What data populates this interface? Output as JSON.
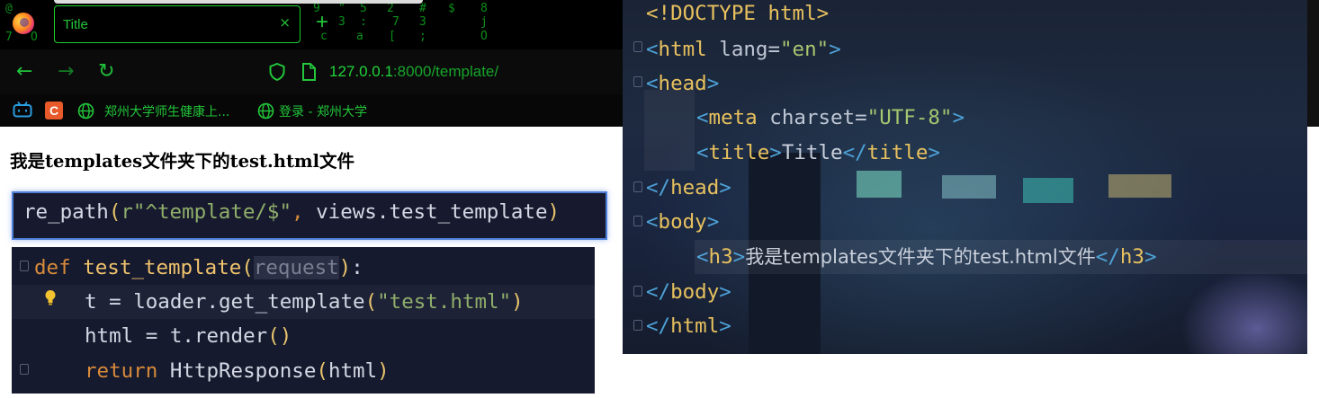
{
  "browser": {
    "tab_title": "Title",
    "url_host": "127.0.0.1",
    "url_rest": ":8000/template/",
    "bookmarks": [
      {
        "label": "郑州大学师生健康上...",
        "icon": "globe-icon"
      },
      {
        "label": "登录 - 郑州大学",
        "icon": "globe-icon"
      }
    ],
    "close_glyph": "×",
    "newtab_glyph": "+",
    "back_glyph": "←",
    "forward_glyph": "→",
    "reload_glyph": "↻",
    "matrix": [
      "@",
      "7",
      "9",
      "\"",
      "5",
      "2",
      "#",
      "$",
      "8",
      "3",
      "\"",
      "&",
      "/",
      "c",
      "l",
      "5",
      "9",
      "O",
      "$",
      "\"",
      ":",
      "7",
      "3",
      "j",
      "a",
      "[",
      ";",
      "O"
    ],
    "colors": {
      "accent": "#22c63a",
      "tab_border": "#1dcf2b"
    }
  },
  "page": {
    "heading": "我是templates文件夹下的test.html文件"
  },
  "code_url": {
    "fn": "re_path",
    "arg_str": "r\"^template/$\"",
    "arg2": "views.test_template"
  },
  "code_def": {
    "line1_kw": "def",
    "line1_fn": "test_template",
    "line1_param": "request",
    "line2_var": "t",
    "line2_call": "loader.get_template",
    "line2_str": "\"test.html\"",
    "line3_var": "html",
    "line3_call": "t.render",
    "line4_kw": "return",
    "line4_call": "HttpResponse",
    "line4_arg": "html"
  },
  "editor": {
    "doctype": "<!DOCTYPE html>",
    "html_tag": "html",
    "lang_attr": "lang",
    "lang_val": "\"en\"",
    "head_tag": "head",
    "meta_tag": "meta",
    "charset_attr": "charset",
    "charset_val": "\"UTF-8\"",
    "title_tag": "title",
    "title_text": "Title",
    "body_tag": "body",
    "h3_tag": "h3",
    "h3_text": "我是templates文件夹下的test.html文件",
    "colors": {
      "tag": "#e8c15e",
      "angle": "#4ea2d8",
      "value": "#a6c66f"
    }
  }
}
